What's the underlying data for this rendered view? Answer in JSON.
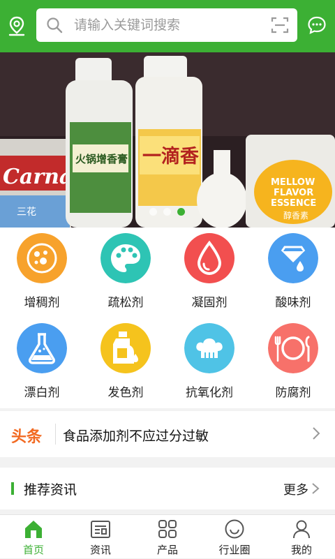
{
  "search": {
    "placeholder": "请输入关键词搜索"
  },
  "categories": [
    {
      "label": "增稠剂",
      "icon": "beads-icon",
      "color": "#f7a22c"
    },
    {
      "label": "疏松剂",
      "icon": "palette-icon",
      "color": "#2ec4b4"
    },
    {
      "label": "凝固剂",
      "icon": "drop-icon",
      "color": "#f24f4f"
    },
    {
      "label": "酸味剂",
      "icon": "paint-bucket-icon",
      "color": "#4a9ef0"
    },
    {
      "label": "漂白剂",
      "icon": "flask-icon",
      "color": "#4a9ef0"
    },
    {
      "label": "发色剂",
      "icon": "bottle-icon",
      "color": "#f5c31d"
    },
    {
      "label": "抗氧化剂",
      "icon": "chef-hat-icon",
      "color": "#4fc3e6"
    },
    {
      "label": "防腐剂",
      "icon": "plate-cutlery-icon",
      "color": "#f7716a"
    }
  ],
  "headline": {
    "tag": "头条",
    "text": "食品添加剂不应过分过敏"
  },
  "recommend": {
    "title": "推荐资讯",
    "more": "更多"
  },
  "tabs": [
    {
      "label": "首页",
      "icon": "home-icon",
      "active": true
    },
    {
      "label": "资讯",
      "icon": "news-icon"
    },
    {
      "label": "产品",
      "icon": "grid-icon"
    },
    {
      "label": "行业圈",
      "icon": "circle-smile-icon"
    },
    {
      "label": "我的",
      "icon": "user-icon"
    }
  ],
  "banner": {
    "active_index": 2,
    "dot_count": 3,
    "texts": {
      "can_brand": "Carnation",
      "can_sub": "三花",
      "bottle1": "火锅增香膏",
      "bottle2": "一滴香",
      "pack_line1": "MELLOW",
      "pack_line2": "FLAVOR",
      "pack_line3": "ESSENCE",
      "pack_cn": "醇香素"
    }
  },
  "colors": {
    "brand": "#3cb034",
    "headline": "#f26a22"
  }
}
